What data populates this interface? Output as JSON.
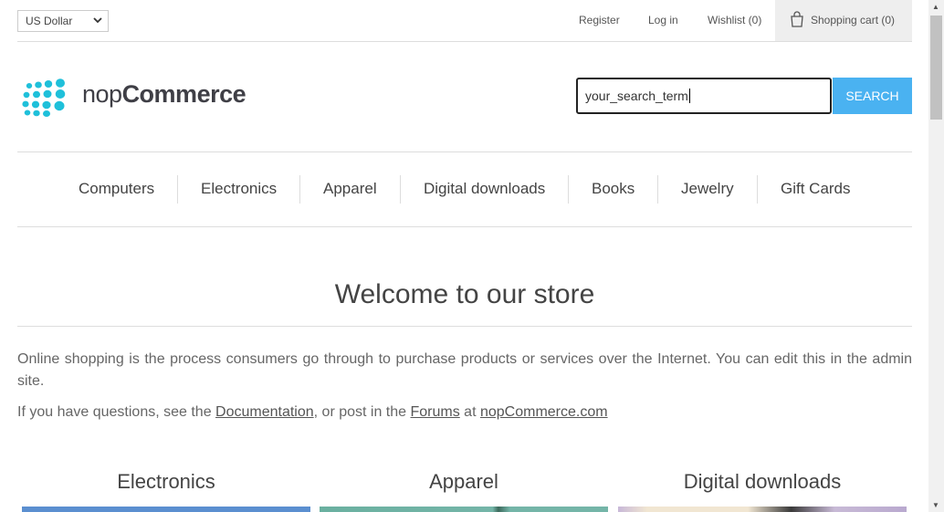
{
  "header": {
    "currency": "US Dollar",
    "links": [
      "Register",
      "Log in",
      "Wishlist (0)"
    ],
    "cart_label": "Shopping cart (0)"
  },
  "logo": {
    "part1": "nop",
    "part2": "Commerce"
  },
  "search": {
    "value": "your_search_term",
    "button": "SEARCH"
  },
  "menu": [
    "Computers",
    "Electronics",
    "Apparel",
    "Digital downloads",
    "Books",
    "Jewelry",
    "Gift Cards"
  ],
  "welcome": {
    "title": "Welcome to our store",
    "paragraph1": "Online shopping is the process consumers go through to purchase products or services over the Internet. You can edit this in the admin site.",
    "p2_prefix": "If you have questions, see the ",
    "p2_link1": "Documentation",
    "p2_mid": ", or post in the ",
    "p2_link2": "Forums",
    "p2_at": " at ",
    "p2_link3": "nopCommerce.com"
  },
  "categories": [
    "Electronics",
    "Apparel",
    "Digital downloads"
  ],
  "colors": {
    "accent": "#4ab2f1",
    "logo_dots": "#1fc0da"
  }
}
